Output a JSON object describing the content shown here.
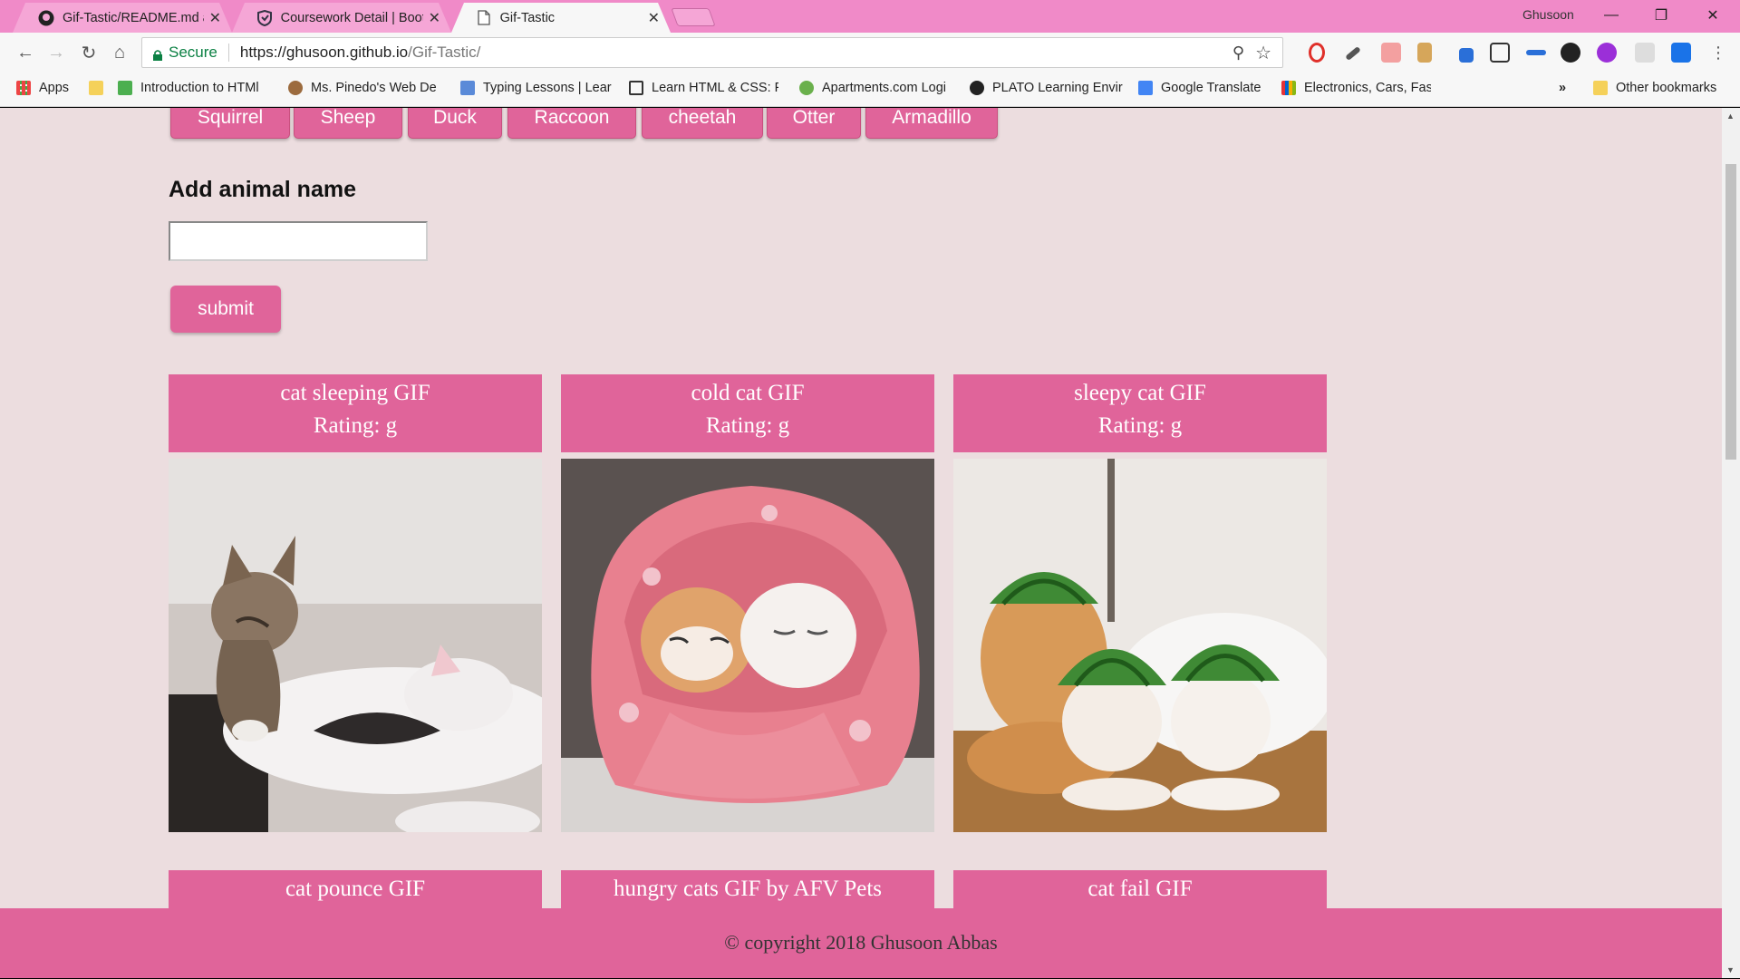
{
  "browser": {
    "tabs": [
      {
        "title": "Gif-Tastic/README.md at",
        "active": false
      },
      {
        "title": "Coursework Detail | Boot",
        "active": false
      },
      {
        "title": "Gif-Tastic",
        "active": true
      }
    ],
    "user": "Ghusoon",
    "address": {
      "secure_label": "Secure",
      "url_host": "https://ghusoon.github.io",
      "url_path": "/Gif-Tastic/"
    },
    "bookmarks": [
      {
        "label": "Apps",
        "icon": "apps-grid-icon"
      },
      {
        "label": "",
        "icon": "folder-icon"
      },
      {
        "label": "Introduction to HTMl",
        "icon": "w3-icon"
      },
      {
        "label": "Ms. Pinedo's Web De",
        "icon": "avatar-icon"
      },
      {
        "label": "Typing Lessons | Lear",
        "icon": "typing-icon"
      },
      {
        "label": "Learn HTML & CSS: P",
        "icon": "code-icon"
      },
      {
        "label": "Apartments.com Logi",
        "icon": "apartments-icon"
      },
      {
        "label": "PLATO Learning Envir",
        "icon": "plato-icon"
      },
      {
        "label": "Google Translate",
        "icon": "translate-icon"
      },
      {
        "label": "Electronics, Cars, Fash",
        "icon": "ebay-icon"
      }
    ],
    "bookmarks_overflow": "»",
    "other_bookmarks": "Other bookmarks"
  },
  "page": {
    "animal_buttons": [
      "Squirrel",
      "Sheep",
      "Duck",
      "Raccoon",
      "cheetah",
      "Otter",
      "Armadillo"
    ],
    "add_label": "Add animal name",
    "input_value": "",
    "submit_label": "submit",
    "gifs": [
      {
        "title": "cat sleeping GIF",
        "rating": "Rating: g"
      },
      {
        "title": "cold cat GIF",
        "rating": "Rating: g"
      },
      {
        "title": "sleepy cat GIF",
        "rating": "Rating: g"
      },
      {
        "title": "cat pounce GIF",
        "rating": ""
      },
      {
        "title": "hungry cats GIF by AFV Pets",
        "rating": ""
      },
      {
        "title": "cat fail GIF",
        "rating": ""
      }
    ],
    "footer": "© copyright 2018 Ghusoon Abbas"
  },
  "colors": {
    "accent": "#e0649a",
    "page_bg": "#ecdddf",
    "tabbar": "#f08ac8"
  }
}
